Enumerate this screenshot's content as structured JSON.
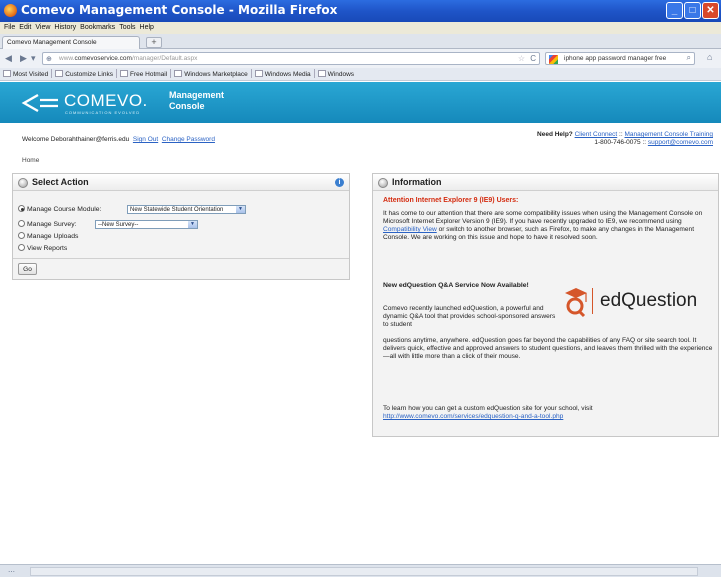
{
  "window": {
    "title": "Comevo Management Console - Mozilla Firefox",
    "minimize": "_",
    "maximize": "□",
    "close": "✕"
  },
  "menu": [
    "File",
    "Edit",
    "View",
    "History",
    "Bookmarks",
    "Tools",
    "Help"
  ],
  "tab": {
    "label": "Comevo Management Console",
    "new_tab": "+"
  },
  "nav": {
    "url_prefix": "www.",
    "url_domain": "comevoservice.com",
    "url_path": "/manager/Default.aspx",
    "search_value": "iphone app password manager free"
  },
  "bookmarks": [
    "Most Visited",
    "Customize Links",
    "Free Hotmail",
    "Windows Marketplace",
    "Windows Media",
    "Windows"
  ],
  "header": {
    "logo_text": "COMEVO.",
    "logo_tagline": "COMMUNICATION EVOLVED",
    "console_line1": "Management",
    "console_line2": "Console"
  },
  "welcome": {
    "text": "Welcome Deborahthainer@ferris.edu",
    "sign_out": "Sign Out",
    "change_password": "Change Password"
  },
  "help": {
    "label": "Need Help?",
    "client_connect": "Client Connect",
    "sep1": " :: ",
    "training": "Management Console Training",
    "phone": "1-800-746-0075",
    "sep2": " :: ",
    "email": "support@comevo.com"
  },
  "breadcrumb": "Home",
  "select_action": {
    "title": "Select Action",
    "options": [
      {
        "label": "Manage Course Module:",
        "selected": true,
        "dropdown": "New Statewide Student Orientation"
      },
      {
        "label": "Manage Survey:",
        "selected": false,
        "dropdown": "--New Survey--"
      },
      {
        "label": "Manage Uploads",
        "selected": false
      },
      {
        "label": "View Reports",
        "selected": false
      }
    ],
    "go_label": "Go"
  },
  "information": {
    "title": "Information",
    "alert_title": "Attention Internet Explorer 9 (IE9) Users:",
    "alert_pre": "It has come to our attention that there are some compatibility issues when using the Management Console on Microsoft Internet Explorer Version 9 (IE9). If you have recently upgraded to IE9, we recommend using ",
    "alert_link": "Compatibility View",
    "alert_post": " or switch to another browser, such as Firefox, to make any changes in the Management Console. We are working on this issue and hope to have it resolved soon.",
    "eq_title": "New edQuestion Q&A Service Now Available!",
    "eq_text1": "Comevo recently launched edQuestion, a powerful and dynamic Q&A tool that provides school-sponsored answers to student",
    "eq_text2": "questions anytime, anywhere. edQuestion goes far beyond the capabilities of any FAQ or site search tool. It delivers quick, effective and approved answers to student questions, and leaves them thrilled with the experience—all with little more than a click of their mouse.",
    "eq_text3": "To learn how you can get a custom edQuestion site for your school, visit",
    "eq_link": "http://www.comevo.com/services/edquestion-q-and-a-tool.php",
    "eq_logo_word": "edQuestion"
  },
  "icons": {
    "firefox": "firefox-icon",
    "info": "info-icon",
    "section": "section-icon"
  },
  "colors": {
    "header_blue": "#1a96c8",
    "alert_red": "#d42c10",
    "link_blue": "#2a62c4",
    "edquestion_orange": "#d5562a"
  }
}
